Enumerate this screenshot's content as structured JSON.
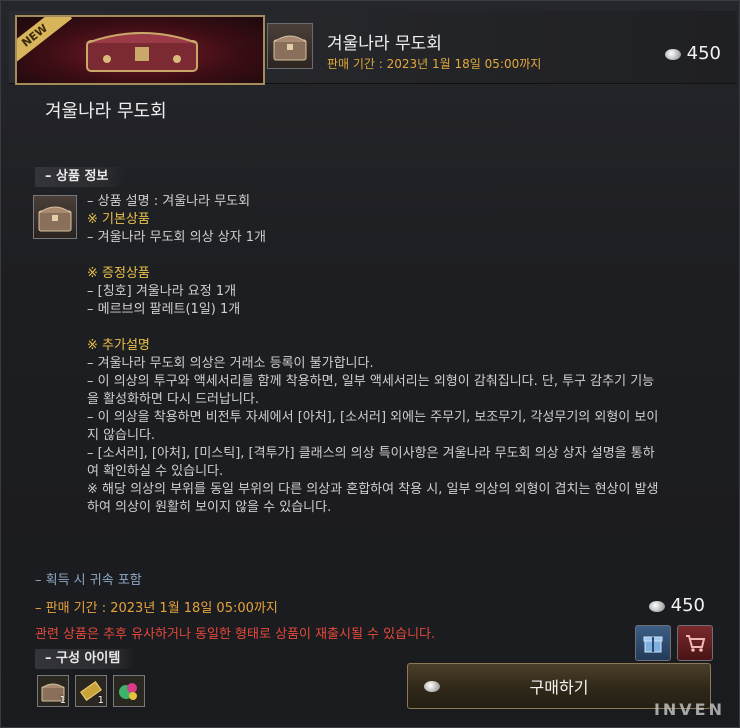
{
  "header": {
    "badge": "NEW",
    "title": "겨울나라 무도회",
    "sale_period": "판매 기간 : 2023년 1월 18일 05:00까지",
    "price": "450"
  },
  "product": {
    "title": "겨울나라 무도회",
    "info_section": "– 상품 정보",
    "description_lines": [
      {
        "text": "– 상품 설명 : 겨울나라 무도회",
        "style": "normal"
      },
      {
        "text": "※ 기본상품",
        "style": "gold"
      },
      {
        "text": "– 겨울나라 무도회 의상 상자 1개",
        "style": "normal"
      },
      {
        "text": "",
        "style": "gap"
      },
      {
        "text": "※ 증정상품",
        "style": "gold"
      },
      {
        "text": "– [칭호] 겨울나라 요정 1개",
        "style": "normal"
      },
      {
        "text": "– 메르브의 팔레트(1일) 1개",
        "style": "normal"
      },
      {
        "text": "",
        "style": "gap"
      },
      {
        "text": "※ 추가설명",
        "style": "gold"
      },
      {
        "text": "– 겨울나라 무도회 의상은 거래소 등록이 불가합니다.",
        "style": "normal"
      },
      {
        "text": "– 이 의상의 투구와 액세서리를 함께 착용하면, 일부 액세서리는 외형이 감춰집니다. 단, 투구 감추기 기능",
        "style": "normal"
      },
      {
        "text": "을 활성화하면 다시 드러납니다.",
        "style": "normal"
      },
      {
        "text": "– 이 의상을 착용하면 비전투 자세에서 [아처], [소서러] 외에는 주무기, 보조무기, 각성무기의 외형이 보이",
        "style": "normal"
      },
      {
        "text": "지 않습니다.",
        "style": "normal"
      },
      {
        "text": "– [소서러], [아처], [미스틱], [격투가] 클래스의 의상 특이사항은 겨울나라 무도회 의상 상자 설명을 통하",
        "style": "normal"
      },
      {
        "text": "여 확인하실 수 있습니다.",
        "style": "normal"
      },
      {
        "text": "※ 해당 의상의 부위를 동일 부위의 다른 의상과 혼합하여 착용 시, 일부 의상의 외형이 겹치는 현상이 발생",
        "style": "normal"
      },
      {
        "text": "하여 의상이 원활히 보이지 않을 수 있습니다.",
        "style": "normal"
      }
    ],
    "bind_note": "– 획득 시 귀속 포함",
    "sale_period": "– 판매 기간 : 2023년 1월 18일 05:00까지",
    "warning": "관련 상품은 추후 유사하거나 동일한 형태로 상품이 재출시될 수 있습니다.",
    "components_section": "– 구성 아이템",
    "components": [
      {
        "icon": "costume-box-icon",
        "count": "1"
      },
      {
        "icon": "title-ticket-icon",
        "count": "1"
      },
      {
        "icon": "palette-icon",
        "count": ""
      }
    ],
    "price": "450",
    "buy_label": "구매하기"
  },
  "colors": {
    "gold": "#e8c04a",
    "sale_orange": "#e7a33c",
    "warning_red": "#e5493a",
    "bind_blue": "#8ea8c2"
  },
  "watermark": "INVEN"
}
